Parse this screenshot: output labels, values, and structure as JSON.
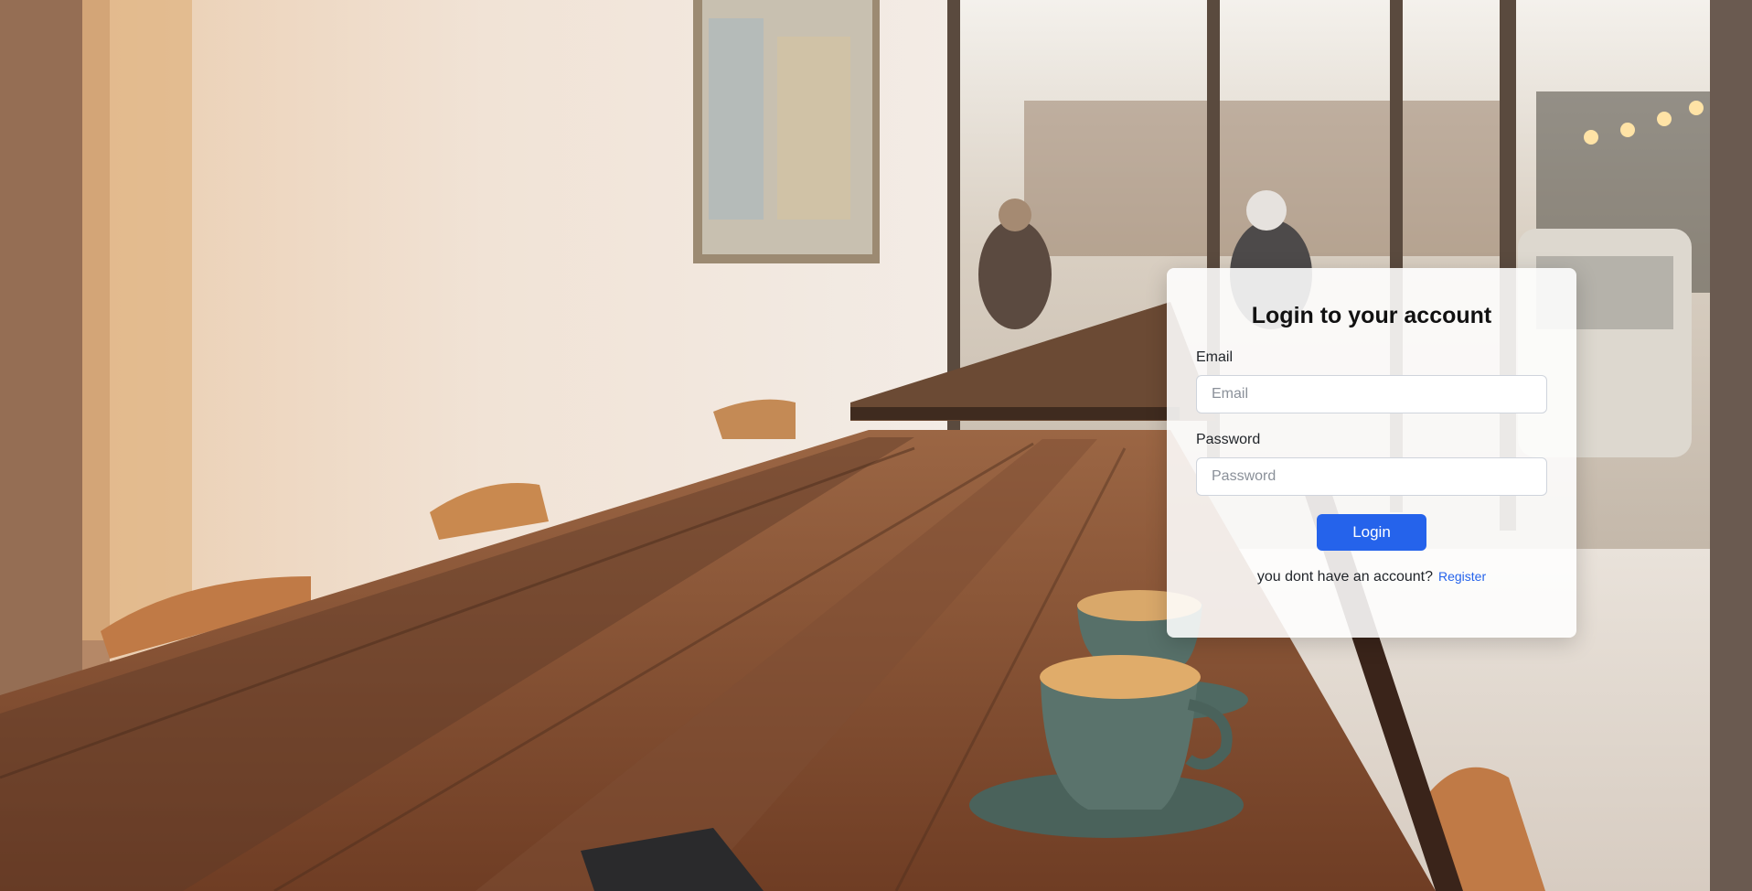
{
  "login": {
    "title": "Login to your account",
    "email_label": "Email",
    "email_placeholder": "Email",
    "email_value": "",
    "password_label": "Password",
    "password_placeholder": "Password",
    "password_value": "",
    "login_button": "Login",
    "register_prompt": "you dont have an account?",
    "register_link": "Register"
  },
  "colors": {
    "accent": "#2563eb",
    "card_background": "#ffffff",
    "title_text": "#111111"
  },
  "background": {
    "icon": "cafe-background-photo"
  }
}
